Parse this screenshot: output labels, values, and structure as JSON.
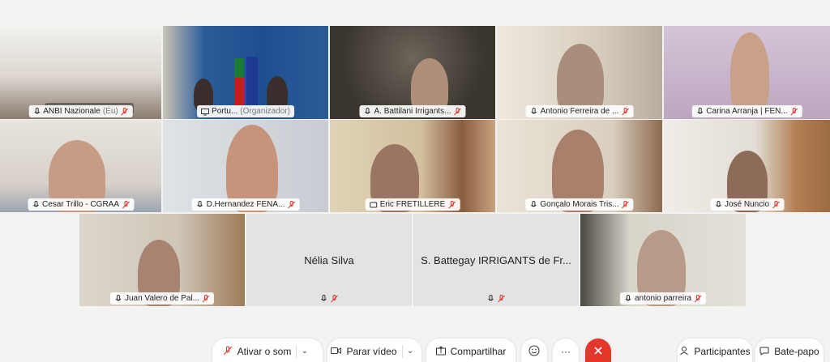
{
  "participants": [
    {
      "name": "ANBI Nazionale",
      "suffix": "(Eu)",
      "icon": "mic-icon",
      "muted": true
    },
    {
      "name": "Portu...",
      "suffix": "(Organizador)",
      "icon": "screen-share-icon",
      "muted": false
    },
    {
      "name": "A. Battilani Irrigants...",
      "suffix": "",
      "icon": "mic-icon",
      "muted": true
    },
    {
      "name": "Antonio Ferreira de ...",
      "suffix": "",
      "icon": "mic-icon",
      "muted": true
    },
    {
      "name": "Carina Arranja | FEN...",
      "suffix": "",
      "icon": "mic-icon",
      "muted": true
    },
    {
      "name": "Cesar Trillo - CGRAA",
      "suffix": "",
      "icon": "mic-icon",
      "muted": true
    },
    {
      "name": "D.Hernandez FENA...",
      "suffix": "",
      "icon": "mic-icon",
      "muted": true
    },
    {
      "name": "Eric FRETILLERE",
      "suffix": "",
      "icon": "phone-icon",
      "muted": true
    },
    {
      "name": "Gonçalo Morais Tris...",
      "suffix": "",
      "icon": "mic-icon",
      "muted": true
    },
    {
      "name": "José Nuncio",
      "suffix": "",
      "icon": "mic-icon",
      "muted": true
    },
    {
      "name": "Juan Valero de Pal...",
      "suffix": "",
      "icon": "mic-icon",
      "muted": true
    },
    {
      "name": "Nélia Silva",
      "suffix": "",
      "icon": "mic-icon",
      "muted": true
    },
    {
      "name": "S. Battegay IRRIGANTS de Fr...",
      "suffix": "",
      "icon": "mic-icon",
      "muted": true
    },
    {
      "name": "antonio parreira",
      "suffix": "",
      "icon": "mic-icon",
      "muted": true
    }
  ],
  "toolbar": {
    "unmute_label": "Ativar o som",
    "stop_video_label": "Parar vídeo",
    "share_label": "Compartilhar",
    "more_label": "···",
    "participants_label": "Participantes",
    "chat_label": "Bate-papo"
  },
  "colors": {
    "active_border": "#2ea8e6",
    "end_button": "#e5362c",
    "mute_red": "#d9342b"
  }
}
